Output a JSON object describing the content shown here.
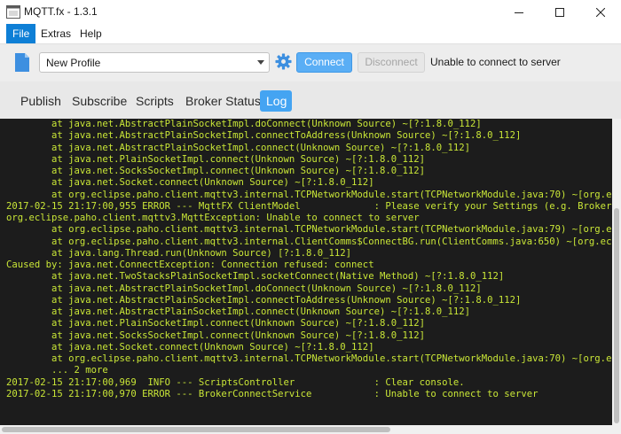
{
  "window": {
    "title": "MQTT.fx - 1.3.1"
  },
  "menu": {
    "items": [
      "File",
      "Extras",
      "Help"
    ]
  },
  "toolbar": {
    "profile": "New Profile",
    "connect_label": "Connect",
    "disconnect_label": "Disconnect",
    "status": "Unable to connect to server",
    "accent": "#5aaef5"
  },
  "tabs": [
    "Publish",
    "Subscribe",
    "Scripts",
    "Broker Status",
    "Log"
  ],
  "active_tab": "Log",
  "log": {
    "text_color": "#c9e637",
    "lines": [
      "        at java.net.AbstractPlainSocketImpl.doConnect(Unknown Source) ~[?:1.8.0_112]",
      "        at java.net.AbstractPlainSocketImpl.connectToAddress(Unknown Source) ~[?:1.8.0_112]",
      "        at java.net.AbstractPlainSocketImpl.connect(Unknown Source) ~[?:1.8.0_112]",
      "        at java.net.PlainSocketImpl.connect(Unknown Source) ~[?:1.8.0_112]",
      "        at java.net.SocksSocketImpl.connect(Unknown Source) ~[?:1.8.0_112]",
      "        at java.net.Socket.connect(Unknown Source) ~[?:1.8.0_112]",
      "        at org.eclipse.paho.client.mqttv3.internal.TCPNetworkModule.start(TCPNetworkModule.java:70) ~[org.ec",
      "2017-02-15 21:17:00,955 ERROR --- MqttFX ClientModel             : Please verify your Settings (e.g. Broker",
      "org.eclipse.paho.client.mqttv3.MqttException: Unable to connect to server",
      "        at org.eclipse.paho.client.mqttv3.internal.TCPNetworkModule.start(TCPNetworkModule.java:79) ~[org.ec",
      "        at org.eclipse.paho.client.mqttv3.internal.ClientComms$ConnectBG.run(ClientComms.java:650) ~[org.ec",
      "        at java.lang.Thread.run(Unknown Source) [?:1.8.0_112]",
      "Caused by: java.net.ConnectException: Connection refused: connect",
      "        at java.net.TwoStacksPlainSocketImpl.socketConnect(Native Method) ~[?:1.8.0_112]",
      "        at java.net.AbstractPlainSocketImpl.doConnect(Unknown Source) ~[?:1.8.0_112]",
      "        at java.net.AbstractPlainSocketImpl.connectToAddress(Unknown Source) ~[?:1.8.0_112]",
      "        at java.net.AbstractPlainSocketImpl.connect(Unknown Source) ~[?:1.8.0_112]",
      "        at java.net.PlainSocketImpl.connect(Unknown Source) ~[?:1.8.0_112]",
      "        at java.net.SocksSocketImpl.connect(Unknown Source) ~[?:1.8.0_112]",
      "        at java.net.Socket.connect(Unknown Source) ~[?:1.8.0_112]",
      "        at org.eclipse.paho.client.mqttv3.internal.TCPNetworkModule.start(TCPNetworkModule.java:70) ~[org.ec",
      "        ... 2 more",
      "2017-02-15 21:17:00,969  INFO --- ScriptsController              : Clear console.",
      "2017-02-15 21:17:00,970 ERROR --- BrokerConnectService           : Unable to connect to server"
    ]
  }
}
